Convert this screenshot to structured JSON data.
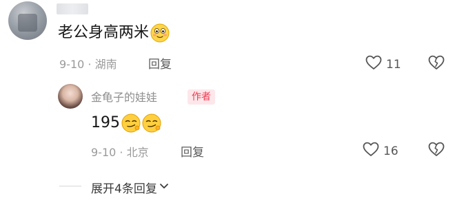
{
  "comment": {
    "text": "老公身高两米",
    "date_location": "9-10 · 湖南",
    "reply_label": "回复",
    "like_count": "11"
  },
  "reply": {
    "username": "金龟子的娃娃",
    "badge": "作者",
    "text": "195",
    "date_location": "9-10 · 北京",
    "reply_label": "回复",
    "like_count": "16"
  },
  "expand_label": "展开4条回复",
  "icons": {
    "like": "heart-outline-icon",
    "dislike": "broken-heart-icon",
    "expand": "chevron-down-icon",
    "emoji_main": "blush-smile-emoji",
    "emoji_reply": "smirk-emoji"
  }
}
